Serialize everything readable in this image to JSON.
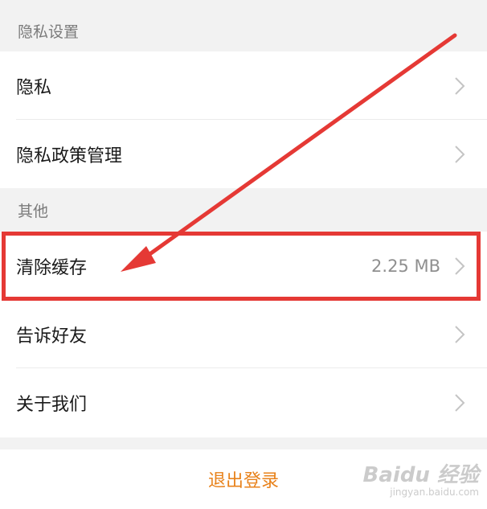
{
  "sections": [
    {
      "header": "隐私设置",
      "items": [
        {
          "label": "隐私"
        },
        {
          "label": "隐私政策管理"
        }
      ]
    },
    {
      "header": "其他",
      "items": [
        {
          "label": "清除缓存",
          "value": "2.25 MB"
        },
        {
          "label": "告诉好友"
        },
        {
          "label": "关于我们"
        }
      ]
    }
  ],
  "logout": {
    "label": "退出登录"
  },
  "annotation": {
    "color": "#e53935"
  },
  "accent": {
    "logout_color": "#e8821b"
  },
  "watermark": {
    "main": "Baidu 经验",
    "sub": "jingyan.baidu.com"
  },
  "icons": {
    "row_chevron": "chevron-right-icon"
  }
}
